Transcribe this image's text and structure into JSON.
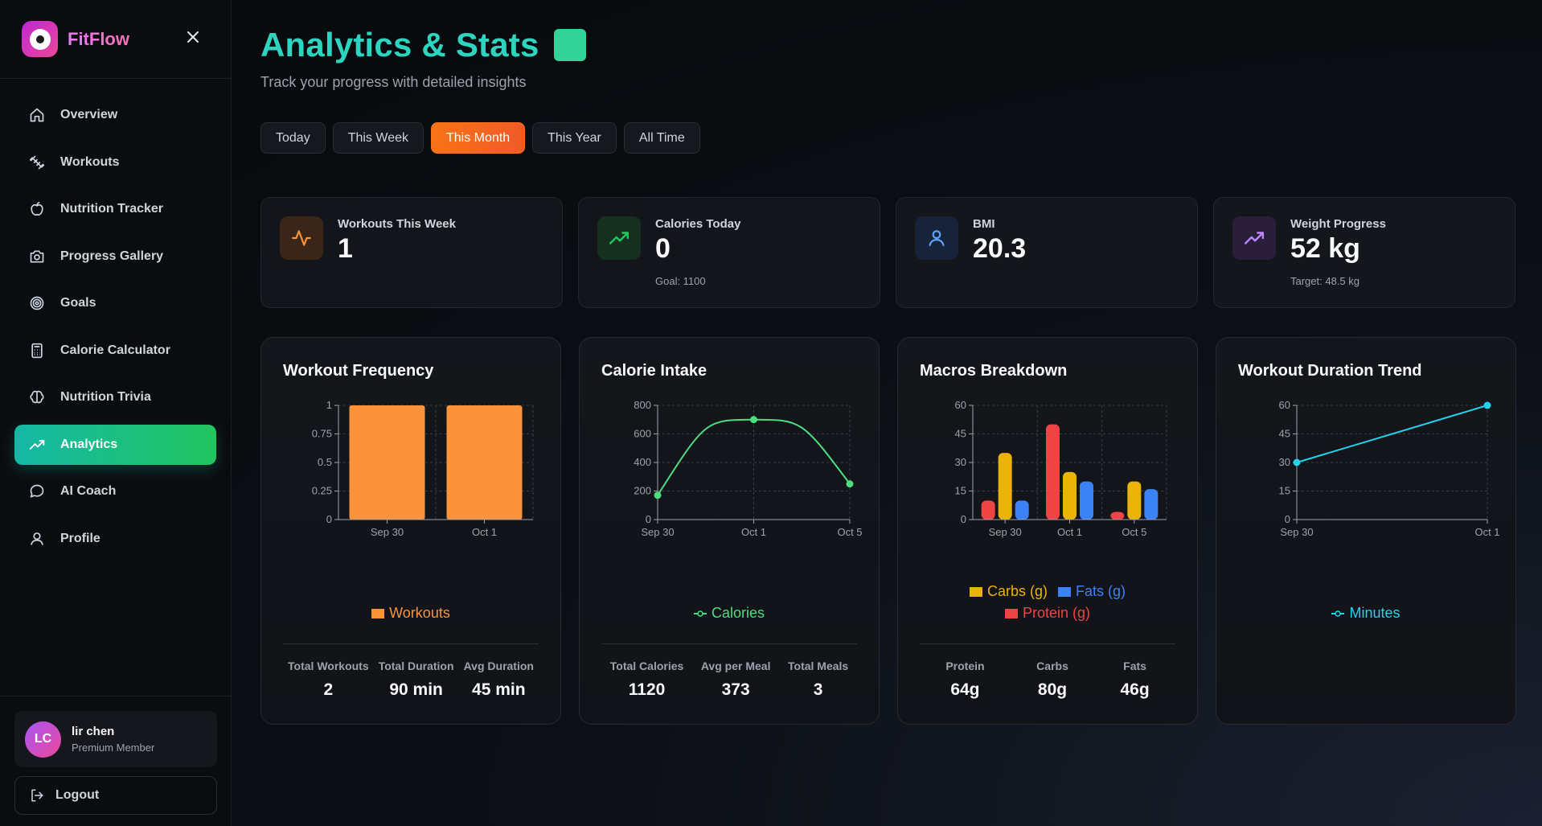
{
  "sidebar": {
    "brand": "FitFlow",
    "items": [
      {
        "label": "Overview",
        "icon": "home-icon"
      },
      {
        "label": "Workouts",
        "icon": "dumbbell-icon"
      },
      {
        "label": "Nutrition Tracker",
        "icon": "apple-icon"
      },
      {
        "label": "Progress Gallery",
        "icon": "camera-icon"
      },
      {
        "label": "Goals",
        "icon": "target-icon"
      },
      {
        "label": "Calorie Calculator",
        "icon": "calculator-icon"
      },
      {
        "label": "Nutrition Trivia",
        "icon": "brain-icon"
      },
      {
        "label": "Analytics",
        "icon": "trending-up-icon",
        "active": true
      },
      {
        "label": "AI Coach",
        "icon": "chat-icon"
      },
      {
        "label": "Profile",
        "icon": "user-icon"
      }
    ],
    "user": {
      "initials": "LC",
      "name": "lir chen",
      "role": "Premium Member"
    },
    "logout_label": "Logout"
  },
  "header": {
    "title": "Analytics & Stats",
    "subtitle": "Track your progress with detailed insights",
    "tabs": [
      "Today",
      "This Week",
      "This Month",
      "This Year",
      "All Time"
    ],
    "active_tab": "This Month"
  },
  "stats": [
    {
      "label": "Workouts This Week",
      "value": "1",
      "sub": "",
      "icon": "activity-icon",
      "color": "#f97316"
    },
    {
      "label": "Calories Today",
      "value": "0",
      "sub": "Goal: 1100",
      "icon": "trending-up-icon",
      "color": "#22c55e"
    },
    {
      "label": "BMI",
      "value": "20.3",
      "sub": "",
      "icon": "user-icon",
      "color": "#3b82f6"
    },
    {
      "label": "Weight Progress",
      "value": "52 kg",
      "sub": "Target: 48.5 kg",
      "icon": "trending-up-icon",
      "color": "#a855f7"
    }
  ],
  "cards": [
    {
      "title": "Workout Frequency",
      "legend": [
        {
          "label": "Workouts",
          "color": "#fb923c",
          "kind": "box"
        }
      ],
      "summary": [
        {
          "label": "Total Workouts",
          "value": "2"
        },
        {
          "label": "Total Duration",
          "value": "90 min"
        },
        {
          "label": "Avg Duration",
          "value": "45 min"
        }
      ]
    },
    {
      "title": "Calorie Intake",
      "legend": [
        {
          "label": "Calories",
          "color": "#4ade80",
          "kind": "line"
        }
      ],
      "summary": [
        {
          "label": "Total Calories",
          "value": "1120"
        },
        {
          "label": "Avg per Meal",
          "value": "373"
        },
        {
          "label": "Total Meals",
          "value": "3"
        }
      ]
    },
    {
      "title": "Macros Breakdown",
      "legend": [
        {
          "label": "Carbs (g)",
          "color": "#eab308",
          "kind": "box"
        },
        {
          "label": "Fats (g)",
          "color": "#3b82f6",
          "kind": "box"
        },
        {
          "label": "Protein (g)",
          "color": "#ef4444",
          "kind": "box"
        }
      ],
      "summary": [
        {
          "label": "Protein",
          "value": "64g"
        },
        {
          "label": "Carbs",
          "value": "80g"
        },
        {
          "label": "Fats",
          "value": "46g"
        }
      ]
    },
    {
      "title": "Workout Duration Trend",
      "legend": [
        {
          "label": "Minutes",
          "color": "#22d3ee",
          "kind": "line"
        }
      ],
      "summary": []
    }
  ],
  "chart_data": [
    {
      "type": "bar",
      "title": "Workout Frequency",
      "categories": [
        "Sep 30",
        "Oct 1"
      ],
      "series": [
        {
          "name": "Workouts",
          "values": [
            1,
            1
          ],
          "color": "#fb923c"
        }
      ],
      "yticks": [
        "0",
        "0.25",
        "0.5",
        "0.75",
        "1"
      ],
      "ylim": [
        0,
        1
      ],
      "grid": true
    },
    {
      "type": "line",
      "title": "Calorie Intake",
      "categories": [
        "Sep 30",
        "Oct 1",
        "Oct 5"
      ],
      "series": [
        {
          "name": "Calories",
          "values": [
            170,
            700,
            250
          ],
          "color": "#4ade80"
        }
      ],
      "yticks": [
        "0",
        "200",
        "400",
        "600",
        "800"
      ],
      "ylim": [
        0,
        800
      ],
      "grid": true
    },
    {
      "type": "bar",
      "title": "Macros Breakdown",
      "categories": [
        "Sep 30",
        "Oct 1",
        "Oct 5"
      ],
      "series": [
        {
          "name": "Protein (g)",
          "values": [
            10,
            50,
            4
          ],
          "color": "#ef4444"
        },
        {
          "name": "Carbs (g)",
          "values": [
            35,
            25,
            20
          ],
          "color": "#eab308"
        },
        {
          "name": "Fats (g)",
          "values": [
            10,
            20,
            16
          ],
          "color": "#3b82f6"
        }
      ],
      "yticks": [
        "0",
        "15",
        "30",
        "45",
        "60"
      ],
      "ylim": [
        0,
        60
      ],
      "grid": true
    },
    {
      "type": "line",
      "title": "Workout Duration Trend",
      "categories": [
        "Sep 30",
        "Oct 1"
      ],
      "series": [
        {
          "name": "Minutes",
          "values": [
            30,
            60
          ],
          "color": "#22d3ee"
        }
      ],
      "yticks": [
        "0",
        "15",
        "30",
        "45",
        "60"
      ],
      "ylim": [
        0,
        60
      ],
      "grid": true
    }
  ]
}
